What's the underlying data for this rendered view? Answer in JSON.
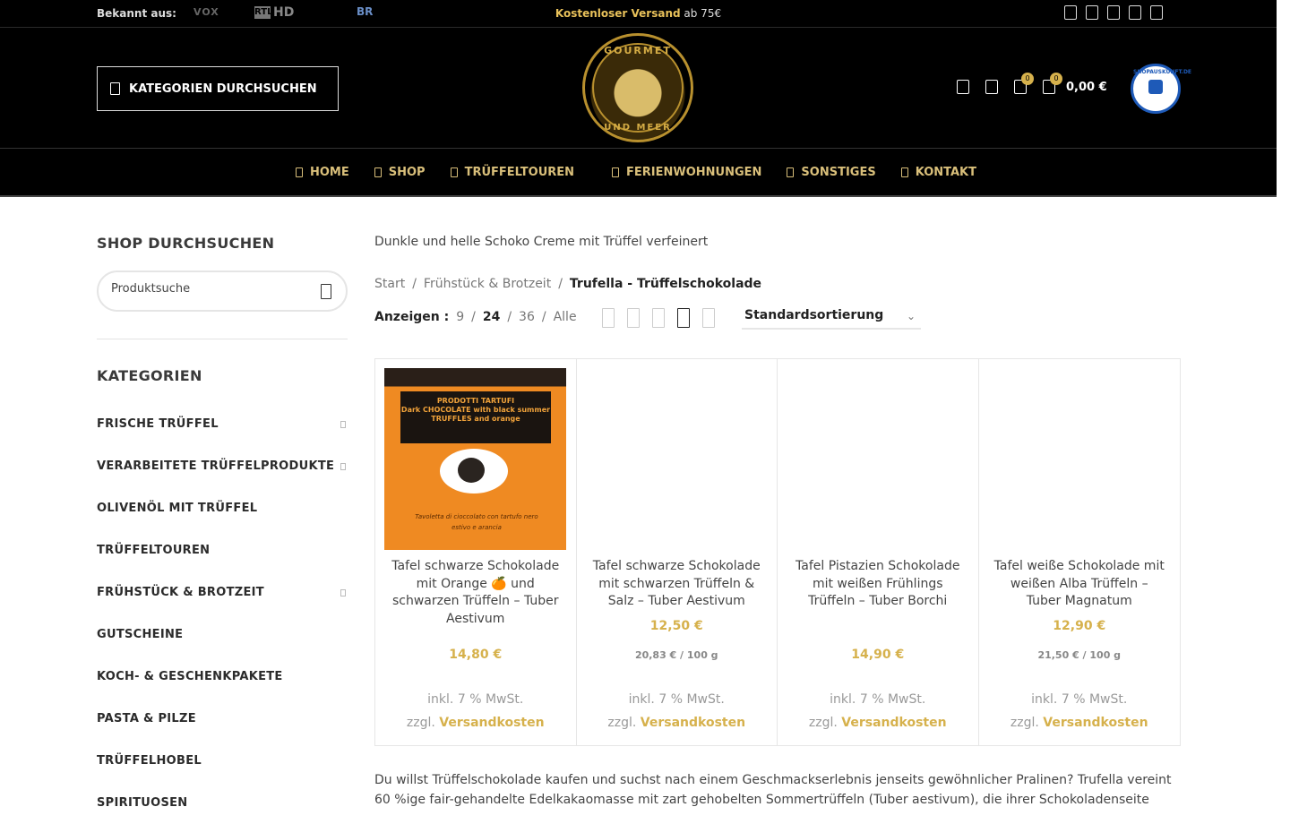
{
  "topbar": {
    "known_from": "Bekannt aus:",
    "media": [
      "VOX",
      "RTL",
      "HD",
      "BR"
    ],
    "shipping_bold": "Kostenloser Versand",
    "shipping_rest": " ab 75€",
    "social_icons": [
      "facebook-icon",
      "instagram-icon",
      "youtube-icon",
      "pinterest-icon",
      "whatsapp-icon"
    ]
  },
  "header": {
    "category_button": "KATEGORIEN DURCHSUCHEN",
    "logo_top": "GOURMET",
    "logo_bottom": "UND MEER",
    "wishlist_count": "0",
    "cart_count": "0",
    "cart_total": "0,00 €",
    "seal_text": "SHOPAUSKUNFT.DE"
  },
  "nav": {
    "items": [
      "HOME",
      "SHOP",
      "TRÜFFELTOUREN",
      "FERIENWOHNUNGEN",
      "SONSTIGES",
      "KONTAKT"
    ]
  },
  "sidebar": {
    "search_title": "SHOP DURCHSUCHEN",
    "search_placeholder": "Produktsuche",
    "categories_title": "KATEGORIEN",
    "categories": [
      {
        "label": "FRISCHE TRÜFFEL",
        "sub": true
      },
      {
        "label": "VERARBEITETE TRÜFFELPRODUKTE",
        "sub": true
      },
      {
        "label": "OLIVENÖL MIT TRÜFFEL",
        "sub": false
      },
      {
        "label": "TRÜFFELTOUREN",
        "sub": false
      },
      {
        "label": "FRÜHSTÜCK & BROTZEIT",
        "sub": true
      },
      {
        "label": "GUTSCHEINE",
        "sub": false
      },
      {
        "label": "KOCH- & GESCHENKPAKETE",
        "sub": false
      },
      {
        "label": "PASTA & PILZE",
        "sub": false
      },
      {
        "label": "TRÜFFELHOBEL",
        "sub": false
      },
      {
        "label": "SPIRITUOSEN",
        "sub": false
      }
    ]
  },
  "main": {
    "intro": "Dunkle und helle Schoko Creme mit Trüffel verfeinert",
    "breadcrumb": [
      "Start",
      "Frühstück & Brotzeit",
      "Trufella - Trüffelschokolade"
    ],
    "show_label": "Anzeigen :",
    "show_options": [
      "9",
      "24",
      "36",
      "Alle"
    ],
    "sort_label": "Standardsortierung",
    "products": [
      {
        "name": "Tafel schwarze Schokolade mit Orange 🍊 und schwarzen Trüffeln – Tuber Aestivum",
        "price": "14,80 €",
        "unit": "",
        "tax": "inkl. 7 % MwSt.",
        "ship_pre": "zzgl. ",
        "ship_link": "Versandkosten",
        "label_text": "Dark CHOCOLATE with black summer TRUFFLES and orange",
        "label_brand": "PRODOTTI TARTUFI",
        "label_hand": "Tavoletta di cioccolato con tartufo nero estivo e arancia"
      },
      {
        "name": "Tafel schwarze Schokolade mit schwarzen Trüffeln & Salz – Tuber Aestivum",
        "price": "12,50 €",
        "unit": "20,83 € / 100 g",
        "tax": "inkl. 7 % MwSt.",
        "ship_pre": "zzgl. ",
        "ship_link": "Versandkosten"
      },
      {
        "name": "Tafel Pistazien Schokolade mit weißen Frühlings Trüffeln – Tuber Borchi",
        "price": "14,90 €",
        "unit": "",
        "tax": "inkl. 7 % MwSt.",
        "ship_pre": "zzgl. ",
        "ship_link": "Versandkosten"
      },
      {
        "name": "Tafel weiße Schokolade mit weißen Alba Trüffeln – Tuber Magnatum",
        "price": "12,90 €",
        "unit": "21,50 € / 100 g",
        "tax": "inkl. 7 % MwSt.",
        "ship_pre": "zzgl. ",
        "ship_link": "Versandkosten"
      }
    ],
    "description": "Du willst Trüffelschokolade kaufen und suchst nach einem Geschmackserlebnis jenseits gewöhnlicher Pralinen? Trufella vereint 60 %ige fair-gehandelte Edelkakaomasse mit zart gehobelten Sommertrüffeln (Tuber aestivum), die ihrer Schokoladenseite"
  }
}
